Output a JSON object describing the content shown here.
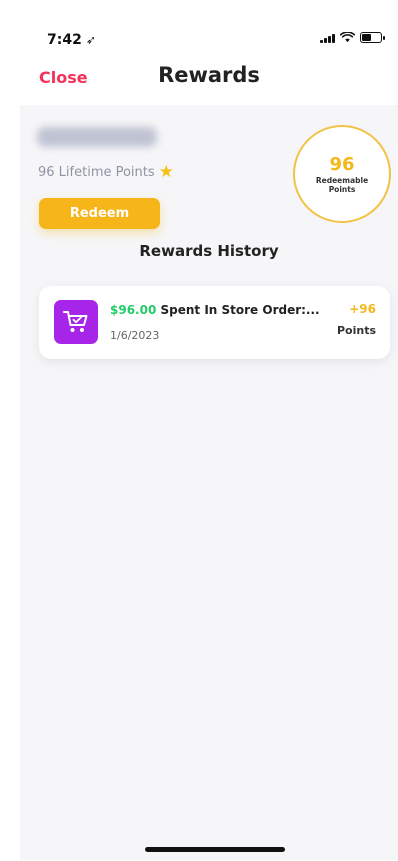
{
  "status_bar": {
    "time": "7:42",
    "location_icon": "location-arrow-icon",
    "signal_icon": "signal-icon",
    "wifi_icon": "wifi-icon",
    "battery_icon": "battery-icon",
    "battery_level": 0.5
  },
  "nav": {
    "close_label": "Close",
    "title": "Rewards"
  },
  "summary": {
    "lifetime_points": "96 Lifetime Points",
    "star_icon": "star-icon",
    "redeem_label": "Redeem",
    "redeemable_value": "96",
    "redeemable_label": "Redeemable Points",
    "history_title": "Rewards History"
  },
  "history": [
    {
      "icon": "shopping-cart-icon",
      "amount": "$96.00",
      "description": " Spent In Store Order:...",
      "date": "1/6/2023",
      "points_delta": "+96",
      "points_unit": "Points"
    }
  ],
  "colors": {
    "close": "#f2315c",
    "accent": "#f6b518",
    "points_gold": "#f4b71c",
    "amount_green": "#22cc66",
    "cart_purple": "#a625e8",
    "muted_text": "#8f93a3",
    "panel_bg": "#f6f6f8"
  }
}
